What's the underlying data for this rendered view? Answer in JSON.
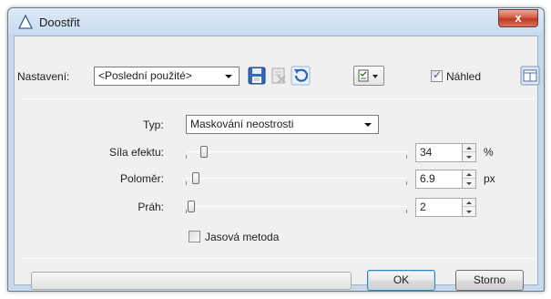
{
  "window": {
    "title": "Doostřit",
    "close_label": "x"
  },
  "toolbar": {
    "preset_label": "Nastavení:",
    "preset_value": "<Poslední použité>",
    "preview_label": "Náhled",
    "preview_checked": true
  },
  "form": {
    "type_label": "Typ:",
    "type_value": "Maskování neostrosti",
    "params": [
      {
        "label": "Síla efektu:",
        "value": "34",
        "unit": "%",
        "slider_fraction": 0.07
      },
      {
        "label": "Poloměr:",
        "value": "6.9",
        "unit": "px",
        "slider_fraction": 0.03
      },
      {
        "label": "Práh:",
        "value": "2",
        "unit": "",
        "slider_fraction": 0.01
      }
    ],
    "luminance_label": "Jasová metoda",
    "luminance_checked": false
  },
  "footer": {
    "ok_label": "OK",
    "cancel_label": "Storno",
    "progress": 0
  },
  "colors": {
    "titlebar": "#c9dcef",
    "close": "#c2391d",
    "accent": "#3c7fb1"
  },
  "icons": [
    "triangle-app-icon",
    "save-icon",
    "delete-icon",
    "undo-icon",
    "options-icon",
    "layout-icon"
  ]
}
